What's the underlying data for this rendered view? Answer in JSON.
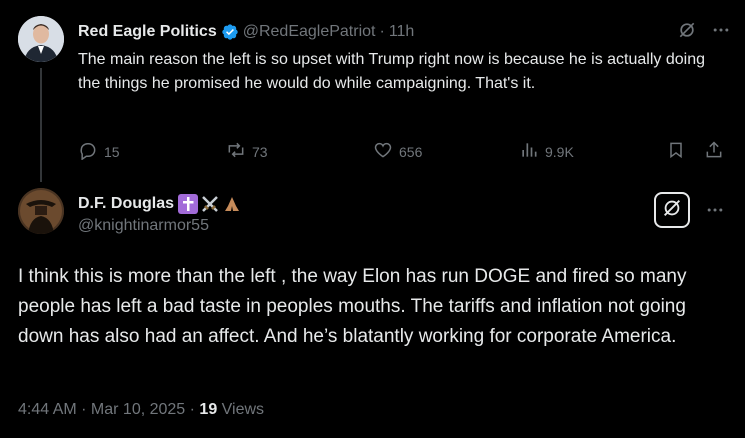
{
  "parent_tweet": {
    "display_name": "Red Eagle Politics",
    "handle": "@RedEaglePatriot",
    "separator": "·",
    "time": "11h",
    "text": "The main reason the left is so upset with Trump right now is because he is actually doing the things he promised he would do while campaigning. That's it.",
    "stats": {
      "replies": "15",
      "reposts": "73",
      "likes": "656",
      "views": "9.9K"
    }
  },
  "reply_tweet": {
    "display_name": "D.F. Douglas",
    "handle": "@knightinarmor55",
    "text": "I think this is more than the left , the way Elon has run DOGE and fired so many people has left a bad taste in peoples mouths. The tariffs and inflation not going down has also had an affect. And he’s blatantly working for corporate America.",
    "timestamp": "4:44 AM · Mar 10, 2025 · ",
    "views_count": "19",
    "views_label": " Views"
  },
  "icons": {
    "verified": "verified-badge-icon",
    "grok": "grok-icon",
    "more": "more-icon",
    "reply": "reply-icon",
    "repost": "repost-icon",
    "like": "like-icon",
    "views": "views-icon",
    "bookmark": "bookmark-icon",
    "share": "share-icon"
  },
  "colors": {
    "background": "#000000",
    "text_primary": "#e7e9ea",
    "text_secondary": "#71767b",
    "verified_blue": "#1d9bf0",
    "thread_line": "#333639"
  }
}
